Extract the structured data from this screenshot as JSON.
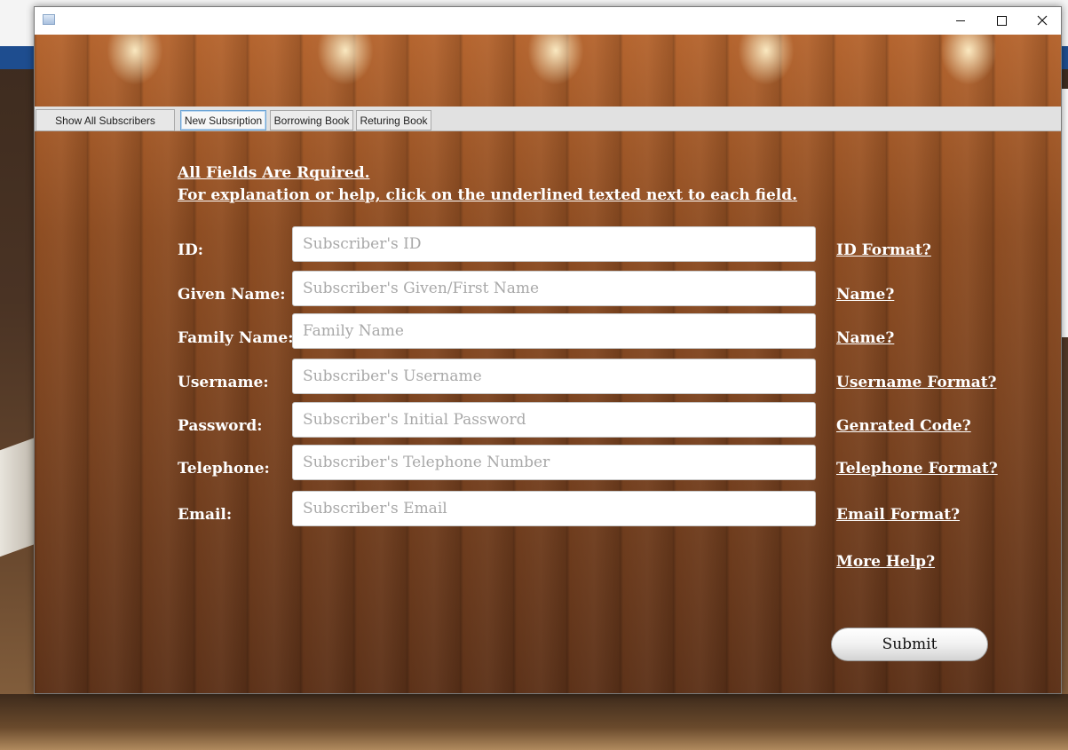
{
  "window": {
    "title": ""
  },
  "tabs": [
    {
      "label": "Show All Subscribers"
    },
    {
      "label": "New Subsription"
    },
    {
      "label": "Borrowing Book"
    },
    {
      "label": "Returing Book"
    }
  ],
  "intro": {
    "line1": "All Fields Are Rquired.",
    "line2": "For explanation or help, click on the underlined texted next to each field."
  },
  "fields": [
    {
      "label": "ID:",
      "placeholder": "Subscriber's ID",
      "help": "ID Format?"
    },
    {
      "label": "Given Name:",
      "placeholder": "Subscriber's Given/First Name",
      "help": "Name?"
    },
    {
      "label": "Family Name:",
      "placeholder": "Family Name",
      "help": "Name?"
    },
    {
      "label": "Username:",
      "placeholder": "Subscriber's Username",
      "help": "Username Format?"
    },
    {
      "label": "Password:",
      "placeholder": "Subscriber's Initial Password",
      "help": "Genrated Code?"
    },
    {
      "label": "Telephone:",
      "placeholder": "Subscriber's Telephone Number",
      "help": "Telephone Format?"
    },
    {
      "label": "Email:",
      "placeholder": "Subscriber's Email",
      "help": "Email Format?"
    }
  ],
  "more_help": "More Help?",
  "submit_label": "Submit"
}
